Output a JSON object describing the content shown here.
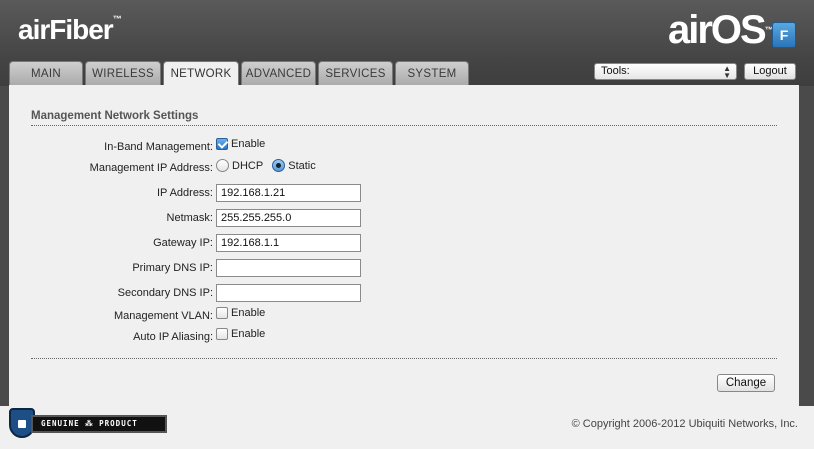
{
  "header": {
    "brand_left": "airFiber",
    "brand_left_tm": "™",
    "brand_right": "airOS",
    "brand_right_tm": "™",
    "brand_badge": "F"
  },
  "tabs": [
    {
      "label": "MAIN"
    },
    {
      "label": "WIRELESS"
    },
    {
      "label": "NETWORK"
    },
    {
      "label": "ADVANCED"
    },
    {
      "label": "SERVICES"
    },
    {
      "label": "SYSTEM"
    }
  ],
  "tools": {
    "selected": "Tools:"
  },
  "logout_label": "Logout",
  "section": {
    "title": "Management Network Settings"
  },
  "form": {
    "inband": {
      "label": "In-Band Management:",
      "option": "Enable",
      "checked": true
    },
    "mgmt_ip": {
      "label": "Management IP Address:",
      "dhcp": "DHCP",
      "static": "Static",
      "selected": "Static"
    },
    "ip_address": {
      "label": "IP Address:",
      "value": "192.168.1.21"
    },
    "netmask": {
      "label": "Netmask:",
      "value": "255.255.255.0"
    },
    "gateway": {
      "label": "Gateway IP:",
      "value": "192.168.1.1"
    },
    "primary_dns": {
      "label": "Primary DNS IP:",
      "value": ""
    },
    "secondary_dns": {
      "label": "Secondary DNS IP:",
      "value": ""
    },
    "mgmt_vlan": {
      "label": "Management VLAN:",
      "option": "Enable",
      "checked": false
    },
    "auto_ip": {
      "label": "Auto IP Aliasing:",
      "option": "Enable",
      "checked": false
    }
  },
  "change_label": "Change",
  "footer": {
    "genuine": "GENUINE  ⁂  PRODUCT",
    "copyright": "© Copyright 2006-2012 Ubiquiti Networks, Inc."
  }
}
